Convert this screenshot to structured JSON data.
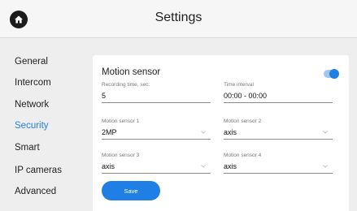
{
  "header": {
    "title": "Settings"
  },
  "sidebar": {
    "items": [
      {
        "label": "General"
      },
      {
        "label": "Intercom"
      },
      {
        "label": "Network"
      },
      {
        "label": "Security"
      },
      {
        "label": "Smart"
      },
      {
        "label": "IP cameras"
      },
      {
        "label": "Advanced"
      }
    ],
    "active_item": "Security"
  },
  "card": {
    "title": "Motion sensor",
    "toggle_on": true,
    "fields": [
      {
        "label": "Recording time, sec.",
        "value": "5"
      },
      {
        "label": "Time interval",
        "value": "00:00 - 00:00"
      },
      {
        "label": "Motion sensor 1",
        "value": "2MP"
      },
      {
        "label": "Motion sensor 2",
        "value": "axis"
      },
      {
        "label": "Motion sensor 3",
        "value": "axis"
      },
      {
        "label": "Motion sensor 4",
        "value": "axis"
      }
    ],
    "save_label": "Save"
  },
  "icons": {
    "home": "home-icon",
    "dropdown": "chevron-down-icon"
  },
  "colors": {
    "accent": "#1f7fe5",
    "background": "#eeeeef",
    "card": "#ffffff"
  }
}
